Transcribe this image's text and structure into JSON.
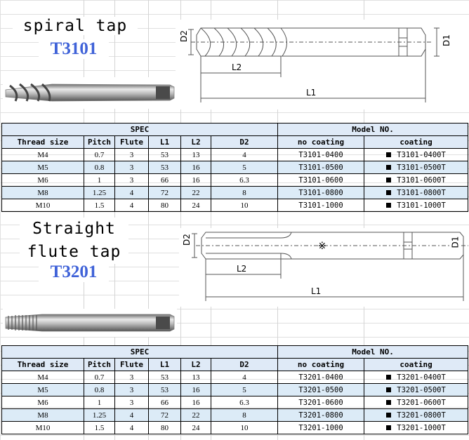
{
  "products": [
    {
      "name": "spiral tap",
      "name_lines": [
        "spiral tap"
      ],
      "code": "T3101",
      "drawing_labels": {
        "d2": "D2",
        "d1": "D1",
        "l2": "L2",
        "l1": "L1"
      },
      "table": {
        "group_spec": "SPEC",
        "group_model": "Model NO.",
        "headers": [
          "Thread size",
          "Pitch",
          "Flute",
          "L1",
          "L2",
          "D2",
          "no coating",
          "coating"
        ],
        "rows": [
          [
            "M4",
            "0.7",
            "3",
            "53",
            "13",
            "4",
            "T3101-0400",
            "T3101-0400T"
          ],
          [
            "M5",
            "0.8",
            "3",
            "53",
            "16",
            "5",
            "T3101-0500",
            "T3101-0500T"
          ],
          [
            "M6",
            "1",
            "3",
            "66",
            "16",
            "6.3",
            "T3101-0600",
            "T3101-0600T"
          ],
          [
            "M8",
            "1.25",
            "4",
            "72",
            "22",
            "8",
            "T3101-0800",
            "T3101-0800T"
          ],
          [
            "M10",
            "1.5",
            "4",
            "80",
            "24",
            "10",
            "T3101-1000",
            "T3101-1000T"
          ]
        ]
      }
    },
    {
      "name": "Straight flute tap",
      "name_lines": [
        "Straight",
        "flute tap"
      ],
      "code": "T3201",
      "drawing_labels": {
        "d2": "D2",
        "d1": "D1",
        "l2": "L2",
        "l1": "L1",
        "mark": "※"
      },
      "table": {
        "group_spec": "SPEC",
        "group_model": "Model NO.",
        "headers": [
          "Thread size",
          "Pitch",
          "Flute",
          "L1",
          "L2",
          "D2",
          "no coating",
          "coating"
        ],
        "rows": [
          [
            "M4",
            "0.7",
            "3",
            "53",
            "13",
            "4",
            "T3201-0400",
            "T3201-0400T"
          ],
          [
            "M5",
            "0.8",
            "3",
            "53",
            "16",
            "5",
            "T3201-0500",
            "T3201-0500T"
          ],
          [
            "M6",
            "1",
            "3",
            "66",
            "16",
            "6.3",
            "T3201-0600",
            "T3201-0600T"
          ],
          [
            "M8",
            "1.25",
            "4",
            "72",
            "22",
            "8",
            "T3201-0800",
            "T3201-0800T"
          ],
          [
            "M10",
            "1.5",
            "4",
            "80",
            "24",
            "10",
            "T3201-1000",
            "T3201-1000T"
          ]
        ]
      }
    }
  ],
  "colors": {
    "code_blue": "#3f62d8",
    "table_header_fill": "#dfeaf7",
    "alt_row_fill": "#dcebf7"
  }
}
